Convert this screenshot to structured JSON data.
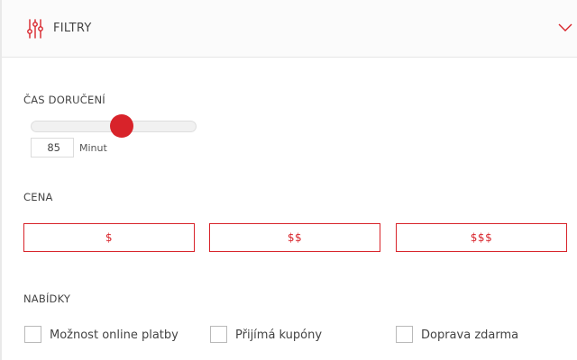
{
  "header": {
    "title": "FILTRY",
    "icon": "sliders-icon",
    "toggle_icon": "chevron-down-icon",
    "accent": "#d8232a"
  },
  "delivery": {
    "label": "ČAS DORUČENÍ",
    "value": "85",
    "unit": "Minut",
    "slider_fraction": 0.55
  },
  "price": {
    "label": "CENA",
    "options": [
      "$",
      "$$",
      "$$$"
    ]
  },
  "offers": {
    "label": "NABÍDKY",
    "items": [
      {
        "label": "Možnost online platby",
        "checked": false
      },
      {
        "label": "Přijímá kupóny",
        "checked": false
      },
      {
        "label": "Doprava zdarma",
        "checked": false
      }
    ]
  }
}
